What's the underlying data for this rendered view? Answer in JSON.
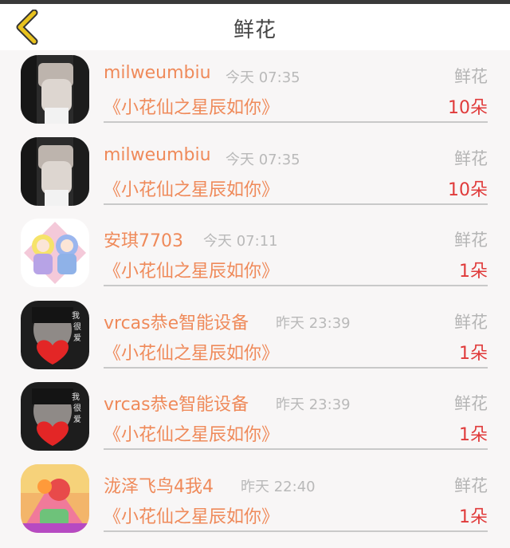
{
  "header": {
    "title": "鲜花"
  },
  "records": [
    {
      "name": "milweumbiu",
      "time": "今天 07:35",
      "gift": "鲜花",
      "song": "《小花仙之星辰如你》",
      "count": "10朵"
    },
    {
      "name": "milweumbiu",
      "time": "今天 07:35",
      "gift": "鲜花",
      "song": "《小花仙之星辰如你》",
      "count": "10朵"
    },
    {
      "name": "安琪7703",
      "time": "今天 07:11",
      "gift": "鲜花",
      "song": "《小花仙之星辰如你》",
      "count": "1朵"
    },
    {
      "name": "vrcas恭e智能设备",
      "time": "昨天 23:39",
      "gift": "鲜花",
      "song": "《小花仙之星辰如你》",
      "count": "1朵"
    },
    {
      "name": "vrcas恭e智能设备",
      "time": "昨天 23:39",
      "gift": "鲜花",
      "song": "《小花仙之星辰如你》",
      "count": "1朵"
    },
    {
      "name": "泷泽飞鸟4我4",
      "time": "昨天 22:40",
      "gift": "鲜花",
      "song": "《小花仙之星辰如你》",
      "count": "1朵"
    }
  ],
  "colors": {
    "accent": "#ef8a5a",
    "count": "#e03a3a",
    "back_icon": "#e8c21e"
  },
  "icons": {
    "back": "chevron-left-icon"
  }
}
